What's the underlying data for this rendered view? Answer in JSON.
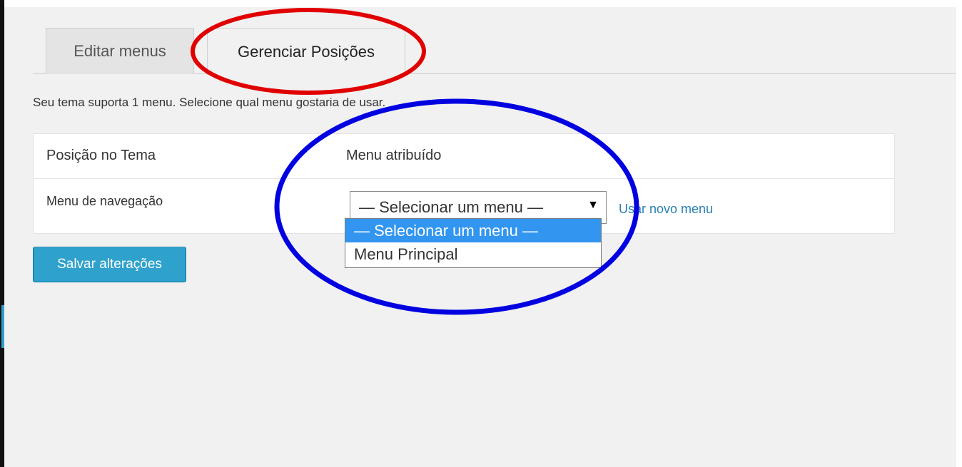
{
  "tabs": [
    {
      "label": "Editar menus"
    },
    {
      "label": "Gerenciar Posições"
    }
  ],
  "intro_text": "Seu tema suporta 1 menu. Selecione qual menu gostaria de usar.",
  "table": {
    "headers": [
      "Posição no Tema",
      "Menu atribuído"
    ],
    "rows": [
      {
        "position": "Menu de navegação",
        "selected": "— Selecionar um menu —",
        "link": "Usar novo menu"
      }
    ]
  },
  "dropdown": {
    "options": [
      "— Selecionar um menu —",
      "Menu Principal"
    ],
    "highlighted_index": 0
  },
  "save_button": "Salvar alterações",
  "colors": {
    "accent": "#2ea2cc",
    "link": "#2a7fb5",
    "highlight": "#3296f0",
    "annotation_red": "#e10000",
    "annotation_blue": "#0000e0"
  },
  "icons": {
    "select_arrow": "caret-down-icon"
  }
}
